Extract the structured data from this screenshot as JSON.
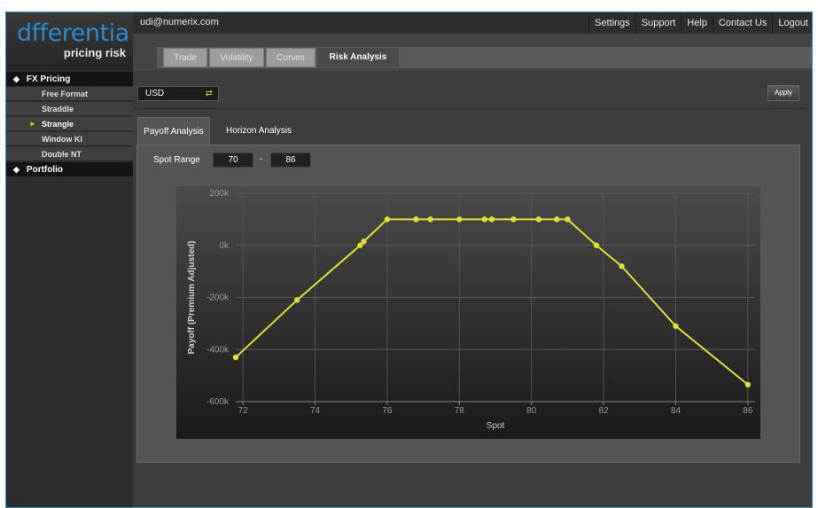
{
  "brand": {
    "logo_word": "dfferentia",
    "tagline": "pricing risk"
  },
  "user": {
    "email": "udi@numerix.com"
  },
  "top_links": [
    "Settings",
    "Support",
    "Help",
    "Contact Us",
    "Logout"
  ],
  "sidebar": {
    "groups": [
      {
        "label": "FX Pricing",
        "items": [
          "Free Format",
          "Straddle",
          "Strangle",
          "Window KI",
          "Double NT"
        ],
        "active_item": "Strangle"
      },
      {
        "label": "Portfolio",
        "items": []
      }
    ]
  },
  "main_tabs": [
    "Trade",
    "Volatility",
    "Curves",
    "Risk Analysis"
  ],
  "active_main_tab": "Risk Analysis",
  "currency": {
    "selected": "USD"
  },
  "apply_label": "Apply",
  "sub_tabs": [
    "Payoff Analysis",
    "Horizon Analysis"
  ],
  "active_sub_tab": "Payoff Analysis",
  "spot_range": {
    "label": "Spot Range",
    "from": "70",
    "separator": "-",
    "to": "86"
  },
  "colors": {
    "series": "#dde033",
    "accent": "#2f86c9"
  },
  "chart_data": {
    "type": "line",
    "xlabel": "Spot",
    "ylabel": "Payoff (Premium Adjusted)",
    "xlim": [
      71.8,
      86.2
    ],
    "ylim": [
      -600000,
      200000
    ],
    "x_ticks": [
      72,
      74,
      76,
      78,
      80,
      82,
      84,
      86
    ],
    "y_ticks": [
      -600000,
      -400000,
      -200000,
      0,
      200000
    ],
    "y_tick_labels": [
      "-600k",
      "-400k",
      "-200k",
      "0k",
      "200k"
    ],
    "grid": true,
    "series": [
      {
        "x": [
          71.8,
          73.5,
          75.25,
          75.35,
          76.0,
          76.8,
          77.2,
          78.0,
          78.7,
          78.9,
          79.5,
          80.2,
          80.7,
          81.0,
          81.8,
          82.5,
          84.0,
          86.0
        ],
        "y": [
          -430000,
          -210000,
          0,
          15000,
          100000,
          100000,
          100000,
          100000,
          100000,
          100000,
          100000,
          100000,
          100000,
          100000,
          0,
          -80000,
          -310000,
          -535000
        ]
      }
    ]
  }
}
